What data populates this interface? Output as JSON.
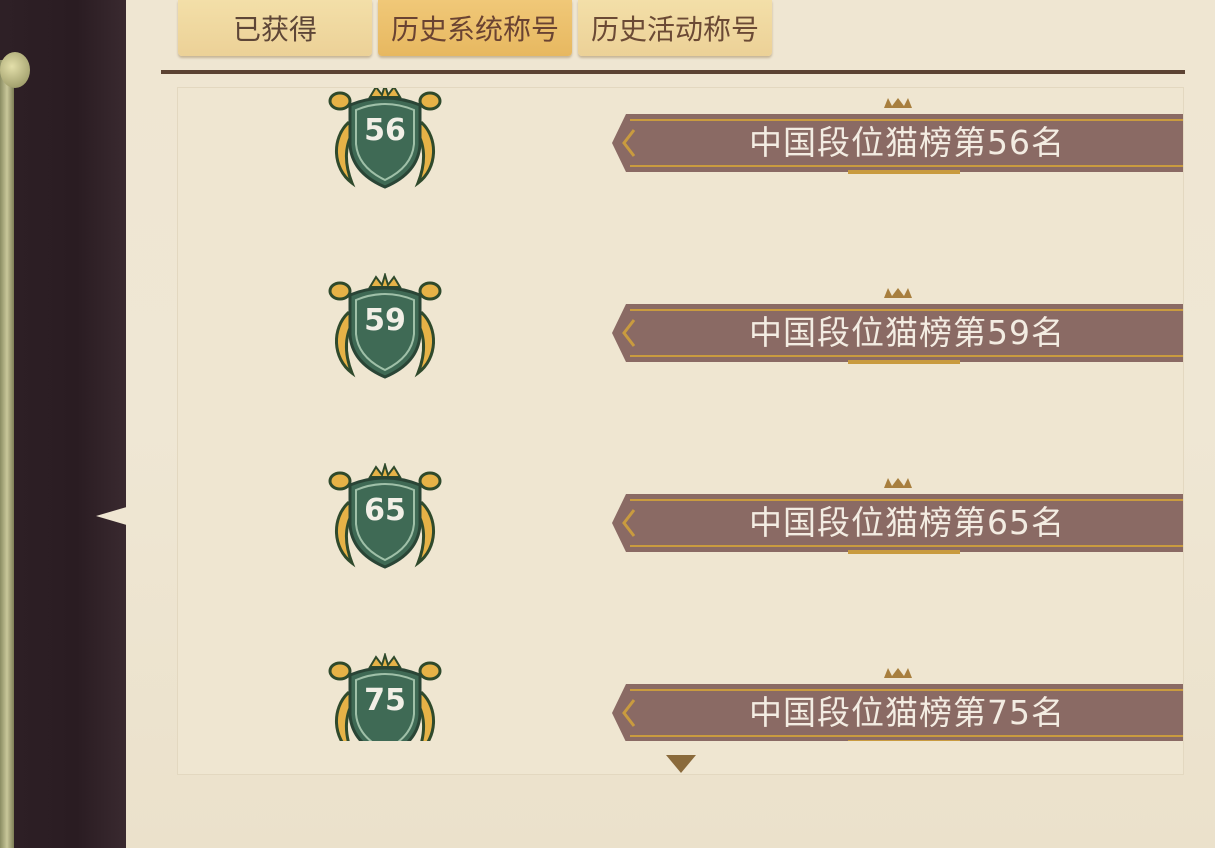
{
  "tabs": [
    {
      "label": "已获得"
    },
    {
      "label": "历史系统称号"
    },
    {
      "label": "历史活动称号"
    }
  ],
  "active_tab_index": 1,
  "titles": [
    {
      "rank": "56",
      "title": "中国段位猫榜第56名"
    },
    {
      "rank": "59",
      "title": "中国段位猫榜第59名"
    },
    {
      "rank": "65",
      "title": "中国段位猫榜第65名"
    },
    {
      "rank": "75",
      "title": "中国段位猫榜第75名"
    }
  ],
  "colors": {
    "badge_green": "#3f6a55",
    "badge_gold": "#e6b247",
    "ribbon": "#8a6a64",
    "accent_gold": "#c99b3f"
  },
  "icons": {
    "rank_badge": "laurel-shield-crown-icon",
    "title_ribbon": "ribbon-banner-icon",
    "scroll_down": "triangle-down-icon"
  }
}
